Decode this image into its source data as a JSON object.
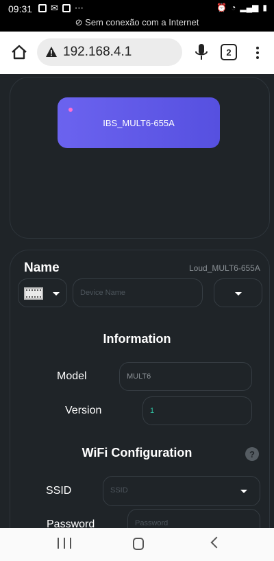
{
  "status_bar": {
    "time": "09:31",
    "connection_message": "Sem conexão com a Internet"
  },
  "browser": {
    "url": "192.168.4.1",
    "tab_count": "2"
  },
  "device_card": {
    "name": "IBS_MULT6-655A"
  },
  "name_section": {
    "title": "Name",
    "current_name": "Loud_MULT6-655A",
    "device_name_placeholder": "Device Name"
  },
  "information": {
    "title": "Information",
    "model_label": "Model",
    "model_value": "MULT6",
    "version_label": "Version",
    "version_value": "1"
  },
  "wifi": {
    "title": "WiFi Configuration",
    "help": "?",
    "ssid_label": "SSID",
    "ssid_placeholder": "SSID",
    "password_label": "Password",
    "password_placeholder": "Password"
  },
  "colors": {
    "page_bg": "#1f2428",
    "card_gradient_start": "#6b63ef",
    "card_gradient_end": "#5650e0",
    "accent_dot": "#ff6fd0",
    "version_value": "#2fbfa0"
  }
}
